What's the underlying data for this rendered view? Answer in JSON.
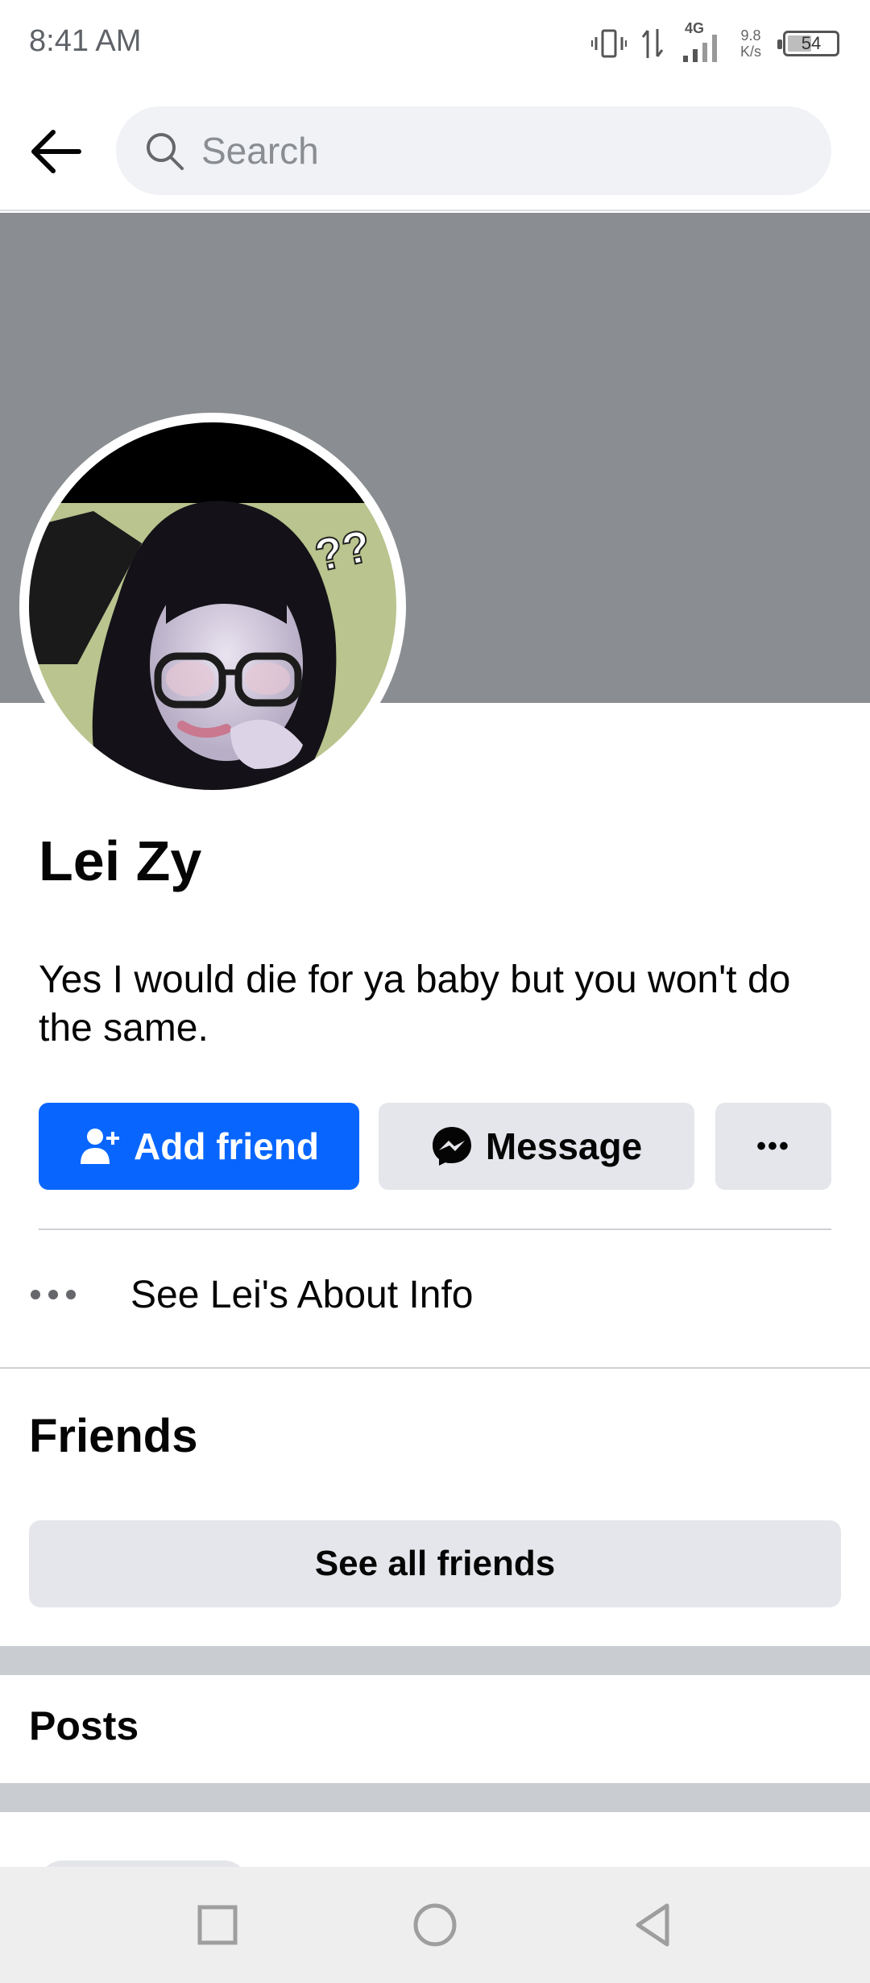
{
  "status_bar": {
    "time": "8:41 AM",
    "network_type": "4G",
    "speed_value": "9.8",
    "speed_unit": "K/s",
    "battery_level": "54",
    "battery_fraction": 0.54
  },
  "header": {
    "search_placeholder": "Search"
  },
  "profile": {
    "name": "Lei Zy",
    "bio": "Yes I would die for ya baby but you won't do the same.",
    "avatar_icon": "profile-photo",
    "cover_color": "#8a8d91"
  },
  "actions": {
    "add_friend_label": "Add friend",
    "message_label": "Message",
    "more_label": "•••"
  },
  "about": {
    "label": "See Lei's About Info"
  },
  "friends": {
    "title": "Friends",
    "see_all_label": "See all friends"
  },
  "posts": {
    "title": "Posts"
  },
  "colors": {
    "accent": "#0866ff",
    "button_gray": "#e4e6eb",
    "separator": "#c9ccd1"
  }
}
